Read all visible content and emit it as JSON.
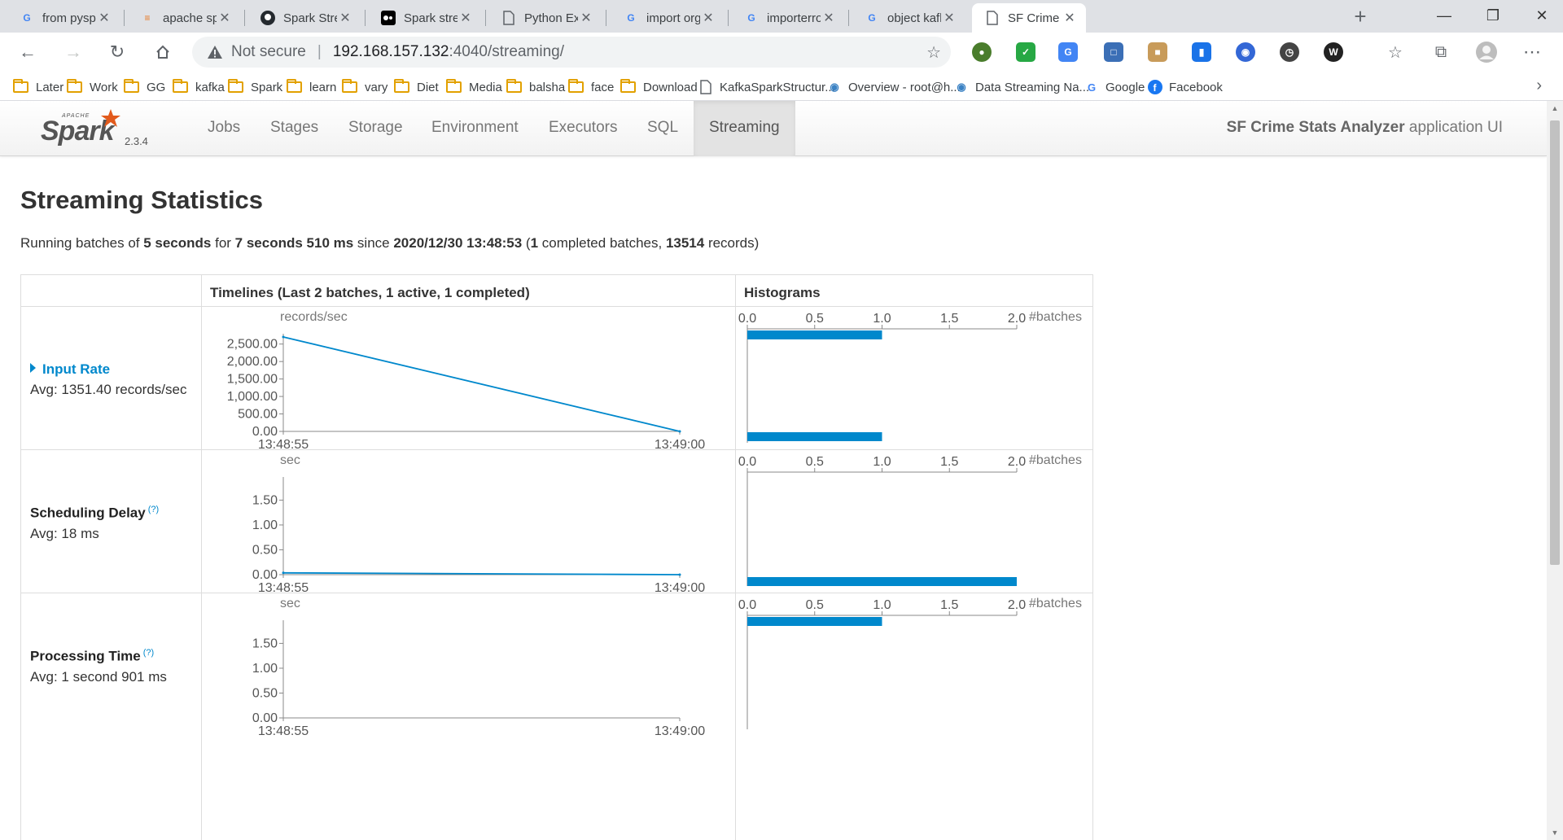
{
  "browser": {
    "tabs": [
      {
        "title": "from pyspark.s",
        "icon": "google-icon"
      },
      {
        "title": "apache spark -",
        "icon": "stackoverflow-icon"
      },
      {
        "title": "Spark Streamin",
        "icon": "github-icon"
      },
      {
        "title": "Spark streamin",
        "icon": "medium-icon"
      },
      {
        "title": "Python Exampl",
        "icon": "page-icon"
      },
      {
        "title": "import org apa",
        "icon": "google-icon"
      },
      {
        "title": "importerror ca",
        "icon": "google-icon"
      },
      {
        "title": "object kafka is",
        "icon": "google-icon"
      },
      {
        "title": "SF Crime Stats",
        "icon": "page-icon",
        "active": true
      }
    ],
    "address": {
      "security": "Not secure",
      "host": "192.168.157.132",
      "path": ":4040/streaming/"
    },
    "bookmarks": [
      {
        "label": "Later",
        "type": "folder"
      },
      {
        "label": "Work",
        "type": "folder"
      },
      {
        "label": "GG",
        "type": "folder"
      },
      {
        "label": "kafka",
        "type": "folder"
      },
      {
        "label": "Spark",
        "type": "folder"
      },
      {
        "label": "learn",
        "type": "folder"
      },
      {
        "label": "vary",
        "type": "folder"
      },
      {
        "label": "Diet",
        "type": "folder"
      },
      {
        "label": "Media",
        "type": "folder"
      },
      {
        "label": "balsha",
        "type": "folder"
      },
      {
        "label": "face",
        "type": "folder"
      },
      {
        "label": "Download",
        "type": "folder"
      },
      {
        "label": "KafkaSparkStructur...",
        "type": "page"
      },
      {
        "label": "Overview - root@h...",
        "type": "site"
      },
      {
        "label": "Data Streaming Na...",
        "type": "site"
      },
      {
        "label": "Google",
        "type": "google"
      },
      {
        "label": "Facebook",
        "type": "facebook"
      }
    ]
  },
  "spark": {
    "version": "2.3.4",
    "nav": [
      "Jobs",
      "Stages",
      "Storage",
      "Environment",
      "Executors",
      "SQL",
      "Streaming"
    ],
    "active_nav": "Streaming",
    "app_name_bold": "SF Crime Stats Analyzer",
    "app_name_suffix": " application UI"
  },
  "page": {
    "title": "Streaming Statistics",
    "summary": {
      "p1": "Running batches of ",
      "batch_interval": "5 seconds",
      "p2": " for ",
      "duration": "7 seconds 510 ms",
      "p3": " since ",
      "since": "2020/12/30 13:48:53",
      "p4": " (",
      "completed": "1",
      "p5": " completed batches, ",
      "records": "13514",
      "p6": " records)"
    },
    "table": {
      "col_timelines": "Timelines (Last 2 batches, 1 active, 1 completed)",
      "col_histograms": "Histograms",
      "rows": [
        {
          "name": "Input Rate",
          "avg": "Avg: 1351.40 records/sec",
          "unit": "records/sec",
          "link": true,
          "tip": ""
        },
        {
          "name": "Scheduling Delay",
          "avg": "Avg: 18 ms",
          "unit": "sec",
          "link": false,
          "tip": "(?)"
        },
        {
          "name": "Processing Time",
          "avg": "Avg: 1 second 901 ms",
          "unit": "sec",
          "link": false,
          "tip": "(?)"
        }
      ]
    }
  },
  "chart_data": [
    {
      "type": "line",
      "title": "Input Rate timeline",
      "ylabel": "records/sec",
      "x": [
        "13:48:55",
        "13:49:00"
      ],
      "values": [
        2702.8,
        0
      ],
      "ylim": [
        0,
        2702.8
      ],
      "yticks": [
        "0.00",
        "500.00",
        "1,000.00",
        "1,500.00",
        "2,000.00",
        "2,500.00"
      ],
      "ytick_values": [
        0,
        500,
        1000,
        1500,
        2000,
        2500
      ],
      "color": "#0088cc"
    },
    {
      "type": "bar",
      "title": "Input Rate histogram",
      "xlabel": "#batches",
      "xticks": [
        "0.0",
        "0.5",
        "1.0",
        "1.5",
        "2.0"
      ],
      "xlim": [
        0,
        2
      ],
      "bins": [
        {
          "range": "high",
          "count": 1
        },
        {
          "range": "low",
          "count": 1
        }
      ],
      "color": "#0088cc"
    },
    {
      "type": "line",
      "title": "Scheduling Delay timeline",
      "ylabel": "sec",
      "x": [
        "13:48:55",
        "13:49:00"
      ],
      "values": [
        0.036,
        0
      ],
      "ylim": [
        0,
        1.9
      ],
      "yticks": [
        "0.00",
        "0.50",
        "1.00",
        "1.50"
      ],
      "ytick_values": [
        0,
        0.5,
        1,
        1.5
      ],
      "color": "#0088cc"
    },
    {
      "type": "bar",
      "title": "Scheduling Delay histogram",
      "xlabel": "#batches",
      "xticks": [
        "0.0",
        "0.5",
        "1.0",
        "1.5",
        "2.0"
      ],
      "xlim": [
        0,
        2
      ],
      "bins": [
        {
          "range": "low",
          "count": 2
        }
      ],
      "color": "#0088cc"
    },
    {
      "type": "line",
      "title": "Processing Time timeline",
      "ylabel": "sec",
      "x": [
        "13:48:55",
        "13:49:00"
      ],
      "values": [],
      "ylim": [
        0,
        1.9
      ],
      "yticks": [
        "0.00",
        "0.50",
        "1.00",
        "1.50"
      ],
      "ytick_values": [
        0,
        0.5,
        1,
        1.5
      ],
      "color": "#0088cc"
    },
    {
      "type": "bar",
      "title": "Processing Time histogram",
      "xlabel": "#batches",
      "xticks": [
        "0.0",
        "0.5",
        "1.0",
        "1.5",
        "2.0"
      ],
      "xlim": [
        0,
        2
      ],
      "bins": [
        {
          "range": "high",
          "count": 1
        }
      ],
      "color": "#0088cc"
    }
  ]
}
